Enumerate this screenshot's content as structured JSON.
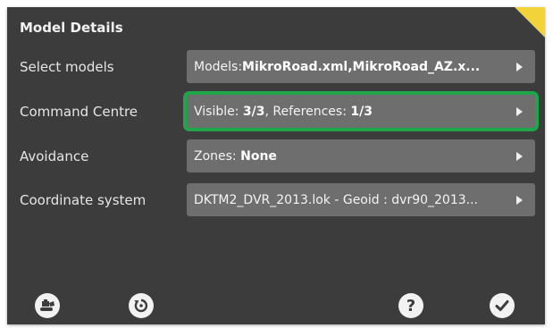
{
  "header": {
    "title": "Model Details"
  },
  "rows": [
    {
      "label": "Select models",
      "value_prefix": "Models:",
      "value_bold": "MikroRoad.xml,MikroRoad_AZ.x..."
    },
    {
      "label": "Command Centre",
      "p1": "Visible: ",
      "b1": "3/3",
      "p2": ", References: ",
      "b2": "1/3"
    },
    {
      "label": "Avoidance",
      "value_prefix": "Zones: ",
      "value_bold": "None"
    },
    {
      "label": "Coordinate system",
      "value": "DKTM2_DVR_2013.lok - Geoid : dvr90_2013..."
    }
  ],
  "footer": {
    "icons": [
      "machine-icon",
      "reset-icon",
      "help-icon",
      "confirm-icon"
    ],
    "help_label": "?"
  },
  "colors": {
    "panel": "#3c3c3c",
    "field": "#6e6e6e",
    "selection": "#1fa64b",
    "corner": "#f2d33a"
  }
}
